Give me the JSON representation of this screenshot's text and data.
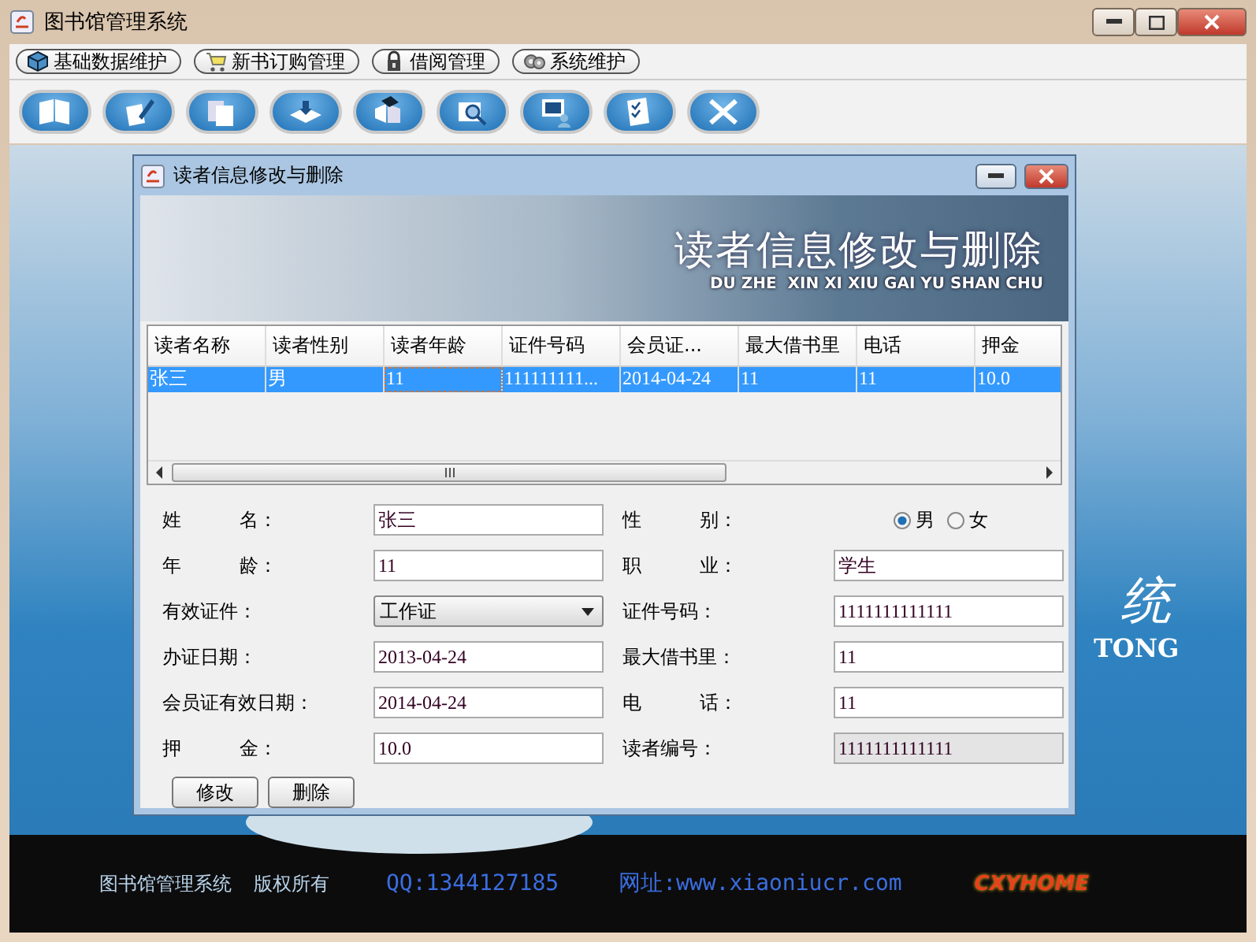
{
  "window": {
    "title": "图书馆管理系统"
  },
  "menu": [
    {
      "label": "基础数据维护"
    },
    {
      "label": "新书订购管理"
    },
    {
      "label": "借阅管理"
    },
    {
      "label": "系统维护"
    }
  ],
  "backdrop": {
    "title_fragment": "统",
    "subtitle_fragment": "TONG"
  },
  "dialog": {
    "title": "读者信息修改与删除",
    "banner": {
      "title": "读者信息修改与删除",
      "subtitle": "DU ZHE  XIN XI XIU GAI YU SHAN CHU"
    },
    "table": {
      "columns": [
        "读者名称",
        "读者性别",
        "读者年龄",
        "证件号码",
        "会员证...",
        "最大借书里",
        "电话",
        "押金"
      ],
      "rows": [
        {
          "cells": [
            "张三",
            "男",
            "11",
            "111111111...",
            "2014-04-24",
            "11",
            "11",
            "10.0"
          ],
          "selected": true
        }
      ]
    },
    "form": {
      "left": [
        {
          "kind": "text",
          "label": "姓 名：",
          "value": "张三",
          "disabled": false
        },
        {
          "kind": "text",
          "label": "年 龄：",
          "value": "11",
          "disabled": false
        },
        {
          "kind": "combo",
          "label": "有效证件：",
          "value": "工作证",
          "disabled": false
        },
        {
          "kind": "text",
          "label": "办证日期：",
          "value": "2013-04-24",
          "disabled": false
        },
        {
          "kind": "text",
          "label": "会员证有效日期：",
          "value": "2014-04-24",
          "disabled": false
        },
        {
          "kind": "text",
          "label": "押 金：",
          "value": "10.0",
          "disabled": false
        }
      ],
      "right": [
        {
          "kind": "radio",
          "label": "性 别：",
          "disabled": false,
          "options": [
            {
              "label": "男",
              "selected": true
            },
            {
              "label": "女",
              "selected": false
            }
          ]
        },
        {
          "kind": "text",
          "label": "职 业：",
          "value": "学生",
          "disabled": false
        },
        {
          "kind": "text",
          "label": "证件号码：",
          "value": "1111111111111",
          "disabled": false
        },
        {
          "kind": "text",
          "label": "最大借书里：",
          "value": "11",
          "disabled": false
        },
        {
          "kind": "text",
          "label": "电 话：",
          "value": "11",
          "disabled": false
        },
        {
          "kind": "text",
          "label": "读者编号：",
          "value": "1111111111111",
          "disabled": true
        }
      ]
    },
    "buttons": [
      "修改",
      "删除"
    ]
  },
  "footer": {
    "name": "图书馆管理系统",
    "copyright": "版权所有",
    "qq": "QQ:1344127185",
    "website": "网址:www.xiaoniucr.com",
    "logo": "CXYHOME"
  }
}
